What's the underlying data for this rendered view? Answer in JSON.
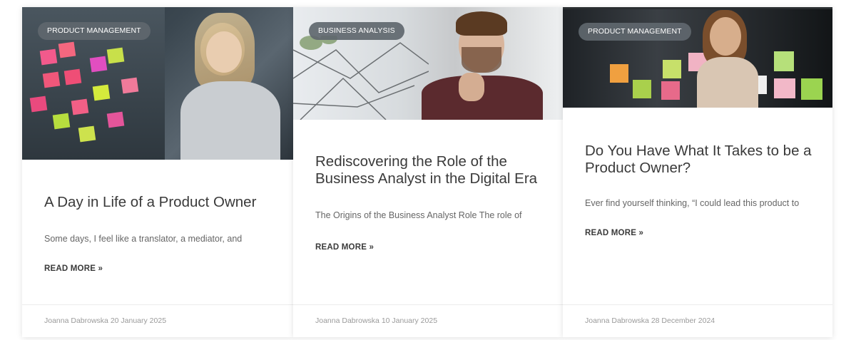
{
  "posts": [
    {
      "category": "PRODUCT MANAGEMENT",
      "title": "A Day in Life of a Product Owner",
      "excerpt": "Some days, I feel like a translator, a mediator, and",
      "read_more": "READ MORE »",
      "author": "Joanna Dabrowska",
      "date": "20 January 2025"
    },
    {
      "category": "BUSINESS ANALYSIS",
      "title": "Rediscovering the Role of the Business Analyst in the Digital Era",
      "excerpt": "The Origins of the Business Analyst Role The role of",
      "read_more": "READ MORE »",
      "author": "Joanna Dabrowska",
      "date": "10 January 2025"
    },
    {
      "category": "PRODUCT MANAGEMENT",
      "title": "Do You Have What It Takes to be a Product Owner?",
      "excerpt": "Ever find yourself thinking, “I could lead this product to",
      "read_more": "READ MORE »",
      "author": "Joanna Dabrowska",
      "date": "28 December 2024"
    }
  ],
  "colors": {
    "badge_bg": "#5f676e",
    "title_text": "#3a3a3a",
    "excerpt_text": "#666666",
    "meta_text": "#9a9a9a"
  }
}
